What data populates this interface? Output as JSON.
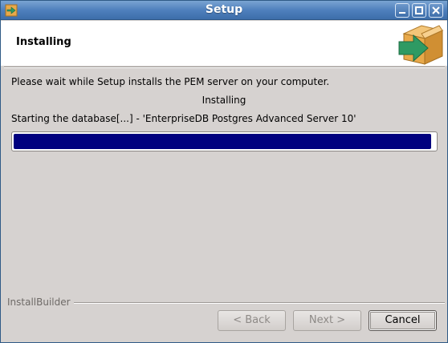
{
  "window": {
    "title": "Setup",
    "controls": [
      "minimize-icon",
      "maximize-icon",
      "close-icon"
    ]
  },
  "header": {
    "title": "Installing",
    "art": "installer-box-arrow-icon"
  },
  "body": {
    "wait_message": "Please wait while Setup installs the PEM server on your computer.",
    "status": "Installing",
    "detail": "Starting the database[...] - 'EnterpriseDB Postgres Advanced Server 10'",
    "progress_fraction": 0.99
  },
  "footer": {
    "brand": "InstallBuilder",
    "back_label": "< Back",
    "next_label": "Next >",
    "cancel_label": "Cancel"
  },
  "colors": {
    "titlebar": "#4f80bd",
    "progress_fill": "#00007f",
    "accent_green": "#2e9a63",
    "box_orange": "#e8a94a"
  }
}
